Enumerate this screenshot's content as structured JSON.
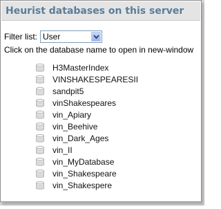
{
  "window": {
    "title": "Heurist databases on this server"
  },
  "filter": {
    "label": "Filter list:",
    "selected": "User",
    "dropdown_icon": "chevron-down-icon"
  },
  "instruction": "Click on the database name to open in new-window",
  "databases": [
    {
      "name": "H3MasterIndex",
      "icon": "database-icon"
    },
    {
      "name": "VINSHAKESPEARESII",
      "icon": "database-icon"
    },
    {
      "name": "sandpit5",
      "icon": "database-icon"
    },
    {
      "name": "vinShakespeares",
      "icon": "database-icon"
    },
    {
      "name": "vin_Apiary",
      "icon": "database-icon"
    },
    {
      "name": "vin_Beehive",
      "icon": "database-icon"
    },
    {
      "name": "vin_Dark_Ages",
      "icon": "database-icon"
    },
    {
      "name": "vin_II",
      "icon": "database-icon"
    },
    {
      "name": "vin_MyDatabase",
      "icon": "database-icon"
    },
    {
      "name": "vin_Shakespeare",
      "icon": "database-icon"
    },
    {
      "name": "vin_Shakespere",
      "icon": "database-icon"
    }
  ],
  "colors": {
    "title_text": "#5a7d9a",
    "title_bar_bg": "#e4e4e4",
    "select_border": "#7f9db9",
    "dropdown_button": "#9ab6ee"
  }
}
